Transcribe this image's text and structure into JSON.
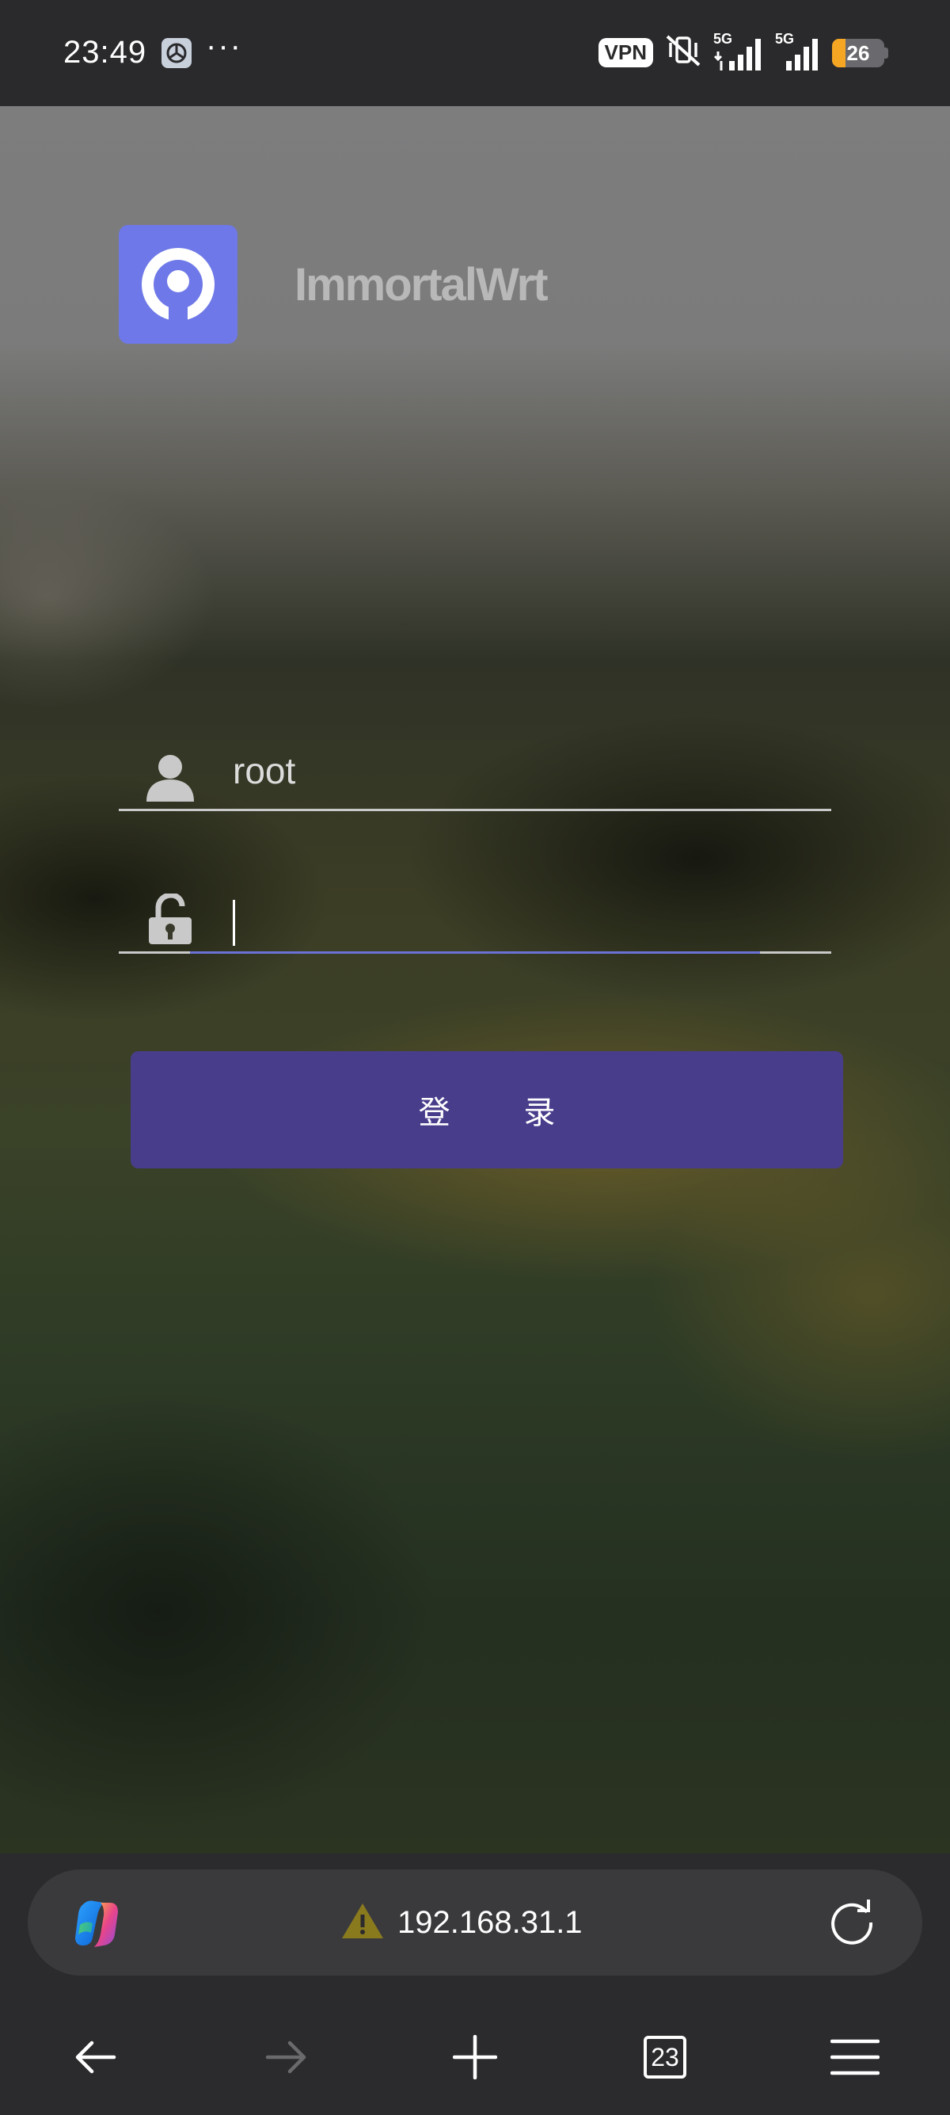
{
  "status_bar": {
    "time": "23:49",
    "overflow": "···",
    "vpn": "VPN",
    "network1": "5G",
    "network2": "5G",
    "battery": "26",
    "battery_level_percent": 26,
    "icons": [
      "app-notification-icon",
      "vibrate-off-icon",
      "signal-icon",
      "signal-icon",
      "battery-icon"
    ]
  },
  "page": {
    "brand": "ImmortalWrt",
    "logo_color": "#6e78e8",
    "username": "root",
    "password": "",
    "login_label": "登 录",
    "button_color": "#483d8b",
    "focus_color": "#6b72d6"
  },
  "browser": {
    "address": "192.168.31.1",
    "tabs_count": "23",
    "warning_color": "#8a7a1e",
    "icons": [
      "copilot-icon",
      "warning-icon",
      "reload-icon",
      "back-icon",
      "forward-icon",
      "new-tab-icon",
      "tabs-icon",
      "menu-icon"
    ]
  }
}
